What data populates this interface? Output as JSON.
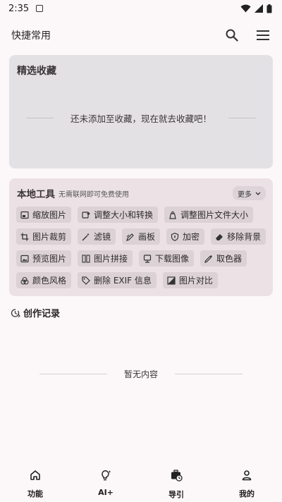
{
  "status_bar": {
    "time": "2:35"
  },
  "app_bar": {
    "title": "快捷常用"
  },
  "favorites": {
    "title": "精选收藏",
    "empty_text": "还未添加至收藏，现在就去收藏吧！"
  },
  "tools": {
    "title": "本地工具",
    "subtitle": "无需联网即可免费使用",
    "more_label": "更多",
    "rows": [
      [
        {
          "label": "缩放图片",
          "icon": "image-scale-icon"
        },
        {
          "label": "调整大小和转换",
          "icon": "resize-convert-icon"
        },
        {
          "label": "调整图片文件大小",
          "icon": "file-weight-icon"
        }
      ],
      [
        {
          "label": "图片裁剪",
          "icon": "crop-icon"
        },
        {
          "label": "滤镜",
          "icon": "magic-wand-icon"
        },
        {
          "label": "画板",
          "icon": "draw-icon"
        },
        {
          "label": "加密",
          "icon": "shield-icon"
        },
        {
          "label": "移除背景",
          "icon": "eraser-icon"
        }
      ],
      [
        {
          "label": "预览图片",
          "icon": "preview-image-icon"
        },
        {
          "label": "图片拼接",
          "icon": "stitch-icon"
        },
        {
          "label": "下载图像",
          "icon": "download-image-icon"
        },
        {
          "label": "取色器",
          "icon": "color-picker-icon"
        }
      ],
      [
        {
          "label": "颜色风格",
          "icon": "palette-icon"
        },
        {
          "label": "删除 EXIF 信息",
          "icon": "tag-icon"
        },
        {
          "label": "图片对比",
          "icon": "compare-icon"
        }
      ]
    ]
  },
  "records": {
    "title": "创作记录",
    "empty_text": "暂无内容"
  },
  "bottom_nav": [
    {
      "label": "功能",
      "icon": "home-icon"
    },
    {
      "label": "AI+",
      "icon": "lightbulb-sparkle-icon"
    },
    {
      "label": "导引",
      "icon": "briefcase-clock-icon"
    },
    {
      "label": "我的",
      "icon": "person-icon"
    }
  ]
}
